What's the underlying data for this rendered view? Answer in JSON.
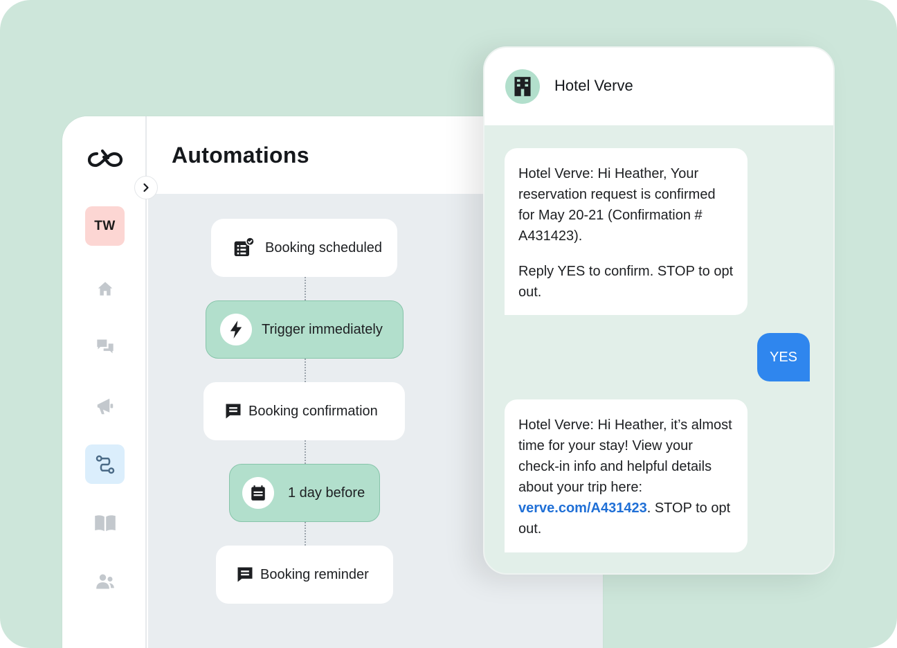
{
  "app": {
    "page_title": "Automations",
    "user_initials": "TW",
    "sidebar_items": [
      {
        "name": "home",
        "icon": "home-icon"
      },
      {
        "name": "messages",
        "icon": "chat-bubbles-icon"
      },
      {
        "name": "campaigns",
        "icon": "megaphone-icon"
      },
      {
        "name": "automations",
        "icon": "workflow-icon",
        "active": true
      },
      {
        "name": "knowledge",
        "icon": "book-icon"
      },
      {
        "name": "contacts",
        "icon": "users-icon"
      }
    ]
  },
  "flow": {
    "nodes": [
      {
        "label": "Booking scheduled",
        "icon": "calendar-check-list-icon",
        "style": "white"
      },
      {
        "label": "Trigger immediately",
        "icon": "lightning-icon",
        "style": "green"
      },
      {
        "label": "Booking confirmation",
        "icon": "message-icon",
        "style": "white"
      },
      {
        "label": "1 day before",
        "icon": "calendar-icon",
        "style": "green"
      },
      {
        "label": "Booking reminder",
        "icon": "message-icon",
        "style": "white"
      }
    ]
  },
  "chat": {
    "contact_name": "Hotel Verve",
    "messages": [
      {
        "direction": "incoming",
        "paragraph1": "Hotel Verve: Hi Heather, Your reservation request is confirmed for May 20-21 (Confirmation # A431423).",
        "paragraph2": "Reply YES to confirm. STOP to opt out."
      },
      {
        "direction": "outgoing",
        "text": "YES"
      },
      {
        "direction": "incoming",
        "text_before_link": "Hotel Verve: Hi Heather, it’s almost time for your stay! View your check-in info and helpful details about your trip here: ",
        "link": "verve.com/A431423",
        "text_after_link": ". STOP to opt out."
      }
    ]
  },
  "colors": {
    "background": "#cde6da",
    "accent_green": "#b2dfcc",
    "outgoing_bubble": "#2f86ee",
    "link": "#1f6fd6",
    "avatar_bg": "#fcd6d3",
    "active_nav": "#dbeefc"
  }
}
